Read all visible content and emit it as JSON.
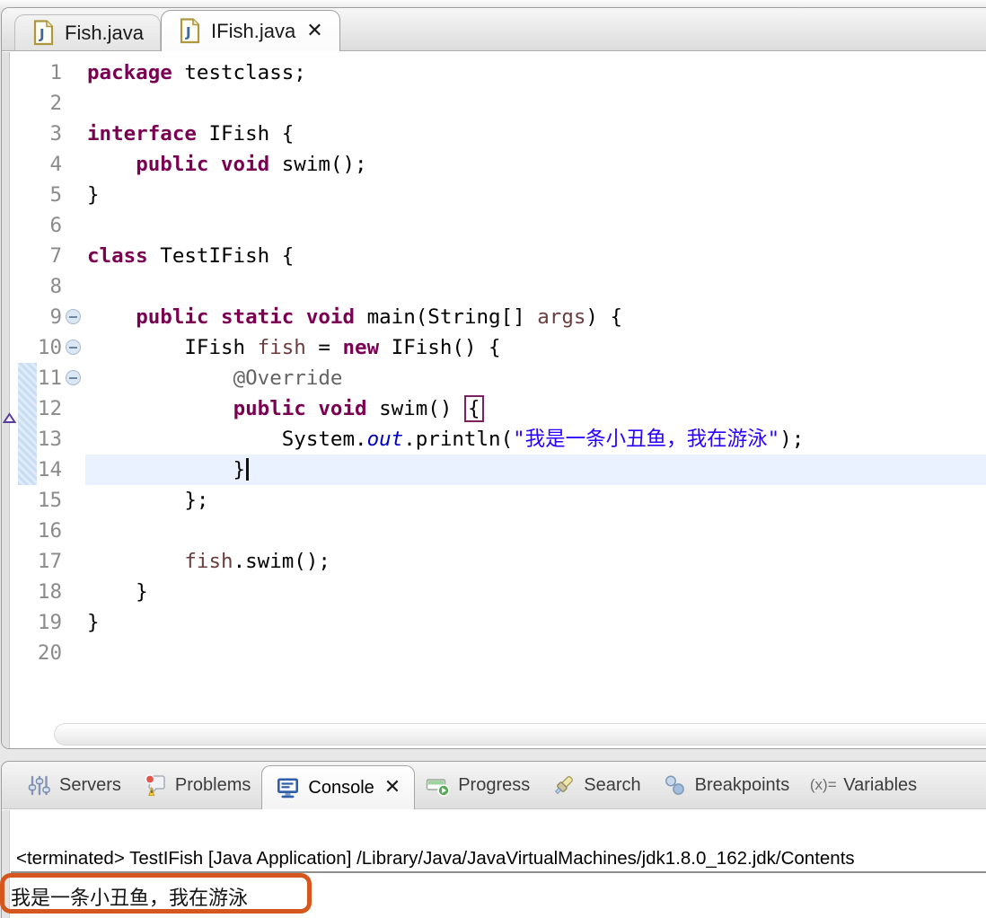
{
  "editor_tabs": [
    {
      "label": "Fish.java",
      "icon": "java-file-icon",
      "active": false,
      "closable": false
    },
    {
      "label": "IFish.java",
      "icon": "java-file-icon",
      "active": true,
      "closable": true
    }
  ],
  "glyphs": {
    "close": "✕",
    "variables_icon_text": "(x)="
  },
  "code": {
    "lines": [
      {
        "num": "1",
        "segs": [
          [
            "kw",
            "package"
          ],
          [
            "pl",
            " testclass;"
          ]
        ]
      },
      {
        "num": "2",
        "segs": []
      },
      {
        "num": "3",
        "segs": [
          [
            "kw",
            "interface"
          ],
          [
            "pl",
            " IFish {"
          ]
        ]
      },
      {
        "num": "4",
        "segs": [
          [
            "pl",
            "    "
          ],
          [
            "kw",
            "public"
          ],
          [
            "pl",
            " "
          ],
          [
            "kw",
            "void"
          ],
          [
            "pl",
            " swim();"
          ]
        ]
      },
      {
        "num": "5",
        "segs": [
          [
            "pl",
            "}"
          ]
        ]
      },
      {
        "num": "6",
        "segs": []
      },
      {
        "num": "7",
        "segs": [
          [
            "kw",
            "class"
          ],
          [
            "pl",
            " TestIFish {"
          ]
        ]
      },
      {
        "num": "8",
        "segs": []
      },
      {
        "num": "9",
        "fold": true,
        "segs": [
          [
            "pl",
            "    "
          ],
          [
            "kw",
            "public"
          ],
          [
            "pl",
            " "
          ],
          [
            "kw",
            "static"
          ],
          [
            "pl",
            " "
          ],
          [
            "kw",
            "void"
          ],
          [
            "pl",
            " main(String[] "
          ],
          [
            "var",
            "args"
          ],
          [
            "pl",
            ") {"
          ]
        ]
      },
      {
        "num": "10",
        "fold": true,
        "segs": [
          [
            "pl",
            "        IFish "
          ],
          [
            "var",
            "fish"
          ],
          [
            "pl",
            " = "
          ],
          [
            "kw",
            "new"
          ],
          [
            "pl",
            " IFish() {"
          ]
        ]
      },
      {
        "num": "11",
        "fold": true,
        "range": true,
        "segs": [
          [
            "pl",
            "            "
          ],
          [
            "ann",
            "@Override"
          ]
        ]
      },
      {
        "num": "12",
        "range": true,
        "override": true,
        "segs": [
          [
            "pl",
            "            "
          ],
          [
            "kw",
            "public"
          ],
          [
            "pl",
            " "
          ],
          [
            "kw",
            "void"
          ],
          [
            "pl",
            " swim() "
          ],
          [
            "brk",
            "{"
          ]
        ]
      },
      {
        "num": "13",
        "range": true,
        "segs": [
          [
            "pl",
            "                System."
          ],
          [
            "fld",
            "out"
          ],
          [
            "pl",
            ".println("
          ],
          [
            "str",
            "\"我是一条小丑鱼，我在游泳\""
          ],
          [
            "pl",
            ");"
          ]
        ]
      },
      {
        "num": "14",
        "range": true,
        "current": true,
        "caret": true,
        "segs": [
          [
            "pl",
            "            }"
          ]
        ]
      },
      {
        "num": "15",
        "segs": [
          [
            "pl",
            "        };"
          ]
        ]
      },
      {
        "num": "16",
        "segs": []
      },
      {
        "num": "17",
        "segs": [
          [
            "pl",
            "        "
          ],
          [
            "var",
            "fish"
          ],
          [
            "pl",
            ".swim();"
          ]
        ]
      },
      {
        "num": "18",
        "segs": [
          [
            "pl",
            "    }"
          ]
        ]
      },
      {
        "num": "19",
        "segs": [
          [
            "pl",
            "}"
          ]
        ]
      },
      {
        "num": "20",
        "segs": []
      }
    ]
  },
  "console_tabs": [
    {
      "label": "Servers",
      "icon": "servers-icon"
    },
    {
      "label": "Problems",
      "icon": "problems-icon"
    },
    {
      "label": "Console",
      "icon": "console-icon",
      "active": true,
      "closable": true
    },
    {
      "label": "Progress",
      "icon": "progress-icon"
    },
    {
      "label": "Search",
      "icon": "search-icon"
    },
    {
      "label": "Breakpoints",
      "icon": "breakpoints-icon"
    },
    {
      "label": "Variables",
      "icon": "variables-icon"
    }
  ],
  "console": {
    "description": "<terminated> TestIFish [Java Application] /Library/Java/JavaVirtualMachines/jdk1.8.0_162.jdk/Contents",
    "output": "我是一条小丑鱼，我在游泳"
  },
  "colors": {
    "keyword": "#7B0052",
    "string": "#2A00FF",
    "annotation": "#646464",
    "local_variable": "#6A3E3E",
    "static_field": "#0000C0",
    "line_number": "#8B8B8B",
    "current_line": "#E9F2FE",
    "annotation_box": "#D6571D",
    "bracket_match": "#7B2160"
  }
}
